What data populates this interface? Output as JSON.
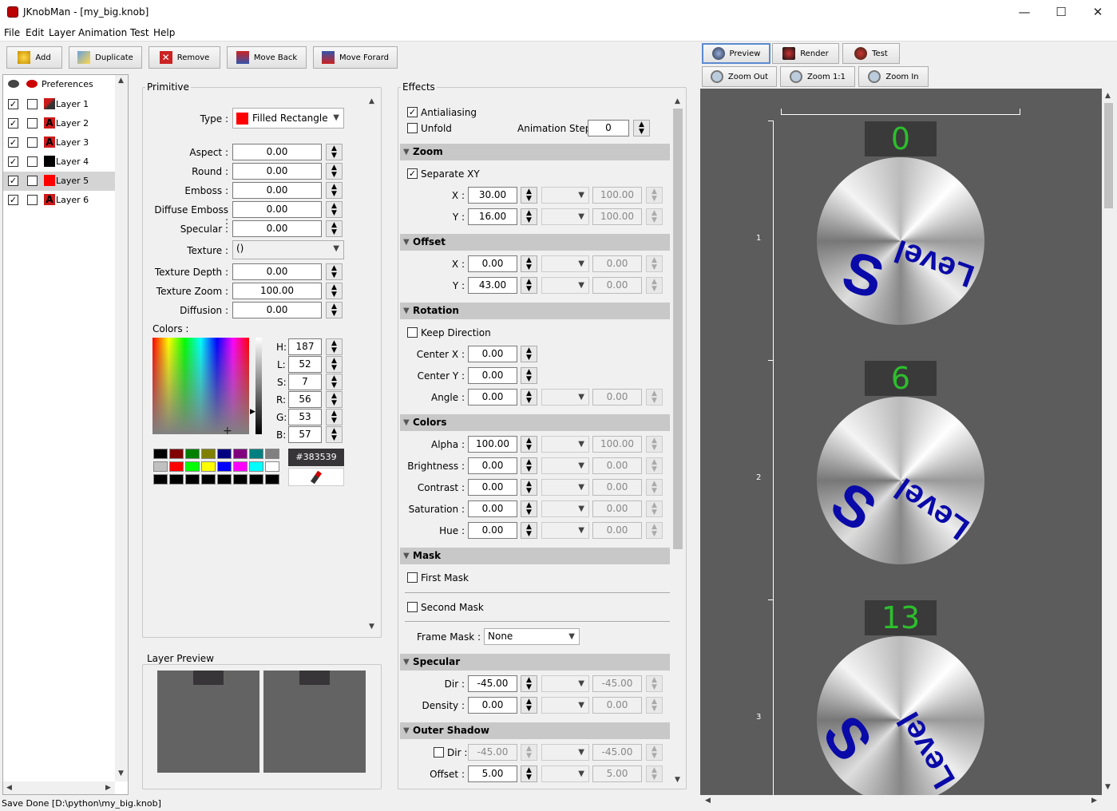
{
  "window": {
    "title": "JKnobMan - [my_big.knob]",
    "minimize": "—",
    "maximize": "☐",
    "close": "✕"
  },
  "menu": [
    "File",
    "Edit",
    "Layer",
    "Animation",
    "Test",
    "Help"
  ],
  "toolbar": {
    "add": "Add",
    "duplicate": "Duplicate",
    "remove": "Remove",
    "move_back": "Move Back",
    "move_forward": "Move Forard"
  },
  "preview_toolbar": {
    "preview": "Preview",
    "render": "Render",
    "test": "Test",
    "zoom_out": "Zoom Out",
    "zoom_11": "Zoom 1:1",
    "zoom_in": "Zoom In"
  },
  "layers": {
    "preferences": "Preferences",
    "items": [
      {
        "name": "Layer 1",
        "visible": true,
        "solo": false,
        "color": "#cc1a1a",
        "icon": "shape"
      },
      {
        "name": "Layer 2",
        "visible": true,
        "solo": false,
        "color": "#cc1a1a",
        "icon": "A"
      },
      {
        "name": "Layer 3",
        "visible": true,
        "solo": false,
        "color": "#cc1a1a",
        "icon": "A"
      },
      {
        "name": "Layer 4",
        "visible": true,
        "solo": false,
        "color": "#000000",
        "icon": "black"
      },
      {
        "name": "Layer 5",
        "visible": true,
        "solo": false,
        "color": "#ff0000",
        "icon": "red"
      },
      {
        "name": "Layer 6",
        "visible": true,
        "solo": false,
        "color": "#cc1a1a",
        "icon": "A"
      }
    ],
    "selected": "Layer 5"
  },
  "primitive": {
    "title": "Primitive",
    "type_label": "Type :",
    "type_value": "Filled Rectangle",
    "fields": [
      {
        "label": "Aspect :",
        "value": "0.00"
      },
      {
        "label": "Round :",
        "value": "0.00"
      },
      {
        "label": "Emboss :",
        "value": "0.00"
      },
      {
        "label": "Diffuse Emboss :",
        "value": "0.00"
      },
      {
        "label": "Specular :",
        "value": "0.00"
      }
    ],
    "texture_label": "Texture :",
    "texture_value": "()",
    "fields2": [
      {
        "label": "Texture Depth :",
        "value": "0.00"
      },
      {
        "label": "Texture Zoom :",
        "value": "100.00"
      },
      {
        "label": "Diffusion :",
        "value": "0.00"
      }
    ],
    "colors_label": "Colors :",
    "hlsrgb": [
      {
        "label": "H:",
        "value": "187"
      },
      {
        "label": "L:",
        "value": "52"
      },
      {
        "label": "S:",
        "value": "7"
      },
      {
        "label": "R:",
        "value": "56"
      },
      {
        "label": "G:",
        "value": "53"
      },
      {
        "label": "B:",
        "value": "57"
      }
    ],
    "hex": "#383539",
    "palette_row1": [
      "#000000",
      "#800000",
      "#008000",
      "#808000",
      "#000080",
      "#800080",
      "#008080",
      "#808080"
    ],
    "palette_row2": [
      "#c0c0c0",
      "#ff0000",
      "#00ff00",
      "#ffff00",
      "#0000ff",
      "#ff00ff",
      "#00ffff",
      "#ffffff"
    ],
    "palette_row3": [
      "#000000",
      "#000000",
      "#000000",
      "#000000",
      "#000000",
      "#000000",
      "#000000",
      "#000000"
    ]
  },
  "layer_preview": {
    "title": "Layer Preview"
  },
  "effects": {
    "title": "Effects",
    "antialiasing": "Antialiasing",
    "unfold": "Unfold",
    "anim_step_label": "Animation Step:",
    "anim_step": "0",
    "zoom": {
      "title": "Zoom",
      "separate": "Separate XY",
      "x_label": "X :",
      "x": "30.00",
      "x_to": "100.00",
      "y_label": "Y :",
      "y": "16.00",
      "y_to": "100.00"
    },
    "offset": {
      "title": "Offset",
      "x_label": "X :",
      "x": "0.00",
      "x_to": "0.00",
      "y_label": "Y :",
      "y": "43.00",
      "y_to": "0.00"
    },
    "rotation": {
      "title": "Rotation",
      "keep": "Keep Direction",
      "cx_label": "Center X :",
      "cx": "0.00",
      "cy_label": "Center Y :",
      "cy": "0.00",
      "angle_label": "Angle :",
      "angle": "0.00",
      "angle_to": "0.00"
    },
    "colors": {
      "title": "Colors",
      "rows": [
        {
          "label": "Alpha :",
          "value": "100.00",
          "to": "100.00"
        },
        {
          "label": "Brightness :",
          "value": "0.00",
          "to": "0.00"
        },
        {
          "label": "Contrast :",
          "value": "0.00",
          "to": "0.00"
        },
        {
          "label": "Saturation :",
          "value": "0.00",
          "to": "0.00"
        },
        {
          "label": "Hue :",
          "value": "0.00",
          "to": "0.00"
        }
      ]
    },
    "mask": {
      "title": "Mask",
      "first": "First Mask",
      "second": "Second Mask",
      "frame_label": "Frame Mask :",
      "frame_value": "None"
    },
    "specular": {
      "title": "Specular",
      "dir_label": "Dir :",
      "dir": "-45.00",
      "dir_to": "-45.00",
      "density_label": "Density :",
      "density": "0.00",
      "density_to": "0.00"
    },
    "outer_shadow": {
      "title": "Outer Shadow",
      "dir_label": "Dir :",
      "dir": "-45.00",
      "dir_to": "-45.00",
      "offset_label": "Offset :",
      "offset": "5.00",
      "offset_to": "5.00"
    }
  },
  "preview": {
    "frames": [
      {
        "label": "1",
        "number": "0"
      },
      {
        "label": "2",
        "number": "6"
      },
      {
        "label": "3",
        "number": "13"
      }
    ],
    "knob_letter": "S",
    "knob_text": "Level"
  },
  "status": "Save Done [D:\\python\\my_big.knob]"
}
